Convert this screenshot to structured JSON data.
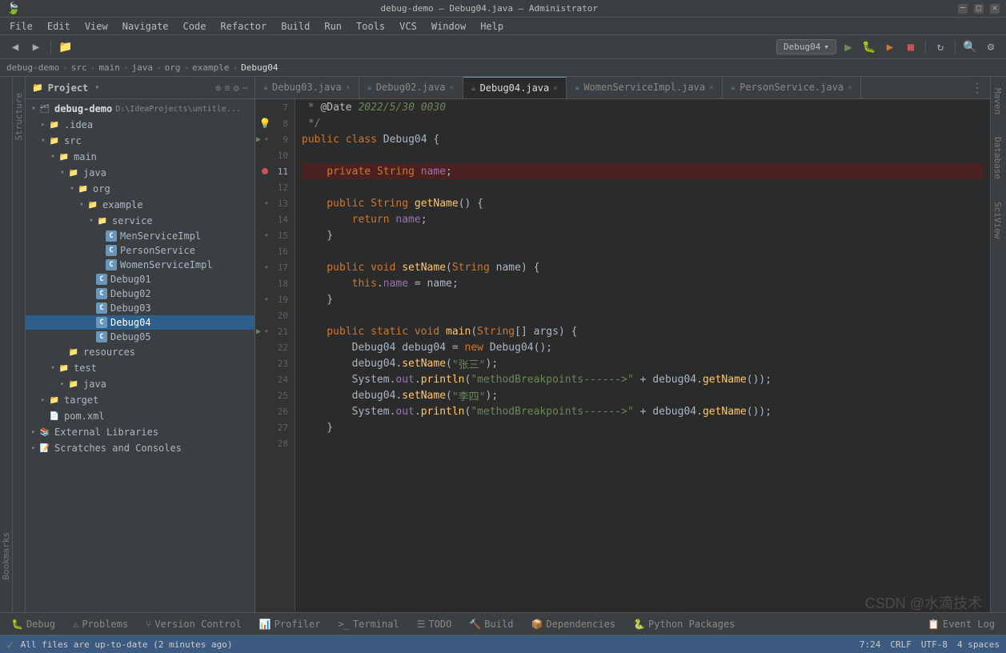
{
  "titleBar": {
    "title": "debug-demo – Debug04.java – Administrator",
    "menuItems": [
      "File",
      "Edit",
      "View",
      "Navigate",
      "Code",
      "Refactor",
      "Build",
      "Run",
      "Tools",
      "VCS",
      "Window",
      "Help"
    ]
  },
  "toolbar": {
    "runConfig": "Debug04",
    "breadcrumb": [
      "debug-demo",
      "src",
      "main",
      "java",
      "org",
      "example",
      "Debug04"
    ]
  },
  "tabs": [
    {
      "name": "Debug03.java",
      "active": false,
      "modified": false
    },
    {
      "name": "Debug02.java",
      "active": false,
      "modified": false
    },
    {
      "name": "Debug04.java",
      "active": true,
      "modified": false
    },
    {
      "name": "WomenServiceImpl.java",
      "active": false,
      "modified": false
    },
    {
      "name": "PersonService.java",
      "active": false,
      "modified": false
    }
  ],
  "tree": {
    "title": "Project",
    "items": [
      {
        "label": "debug-demo",
        "type": "project",
        "indent": 0,
        "open": true,
        "path": "D:\\IdeaProjects\\untitle..."
      },
      {
        "label": ".idea",
        "type": "folder",
        "indent": 1,
        "open": false
      },
      {
        "label": "src",
        "type": "folder-src",
        "indent": 1,
        "open": true
      },
      {
        "label": "main",
        "type": "folder",
        "indent": 2,
        "open": true
      },
      {
        "label": "java",
        "type": "folder-java",
        "indent": 3,
        "open": true
      },
      {
        "label": "org",
        "type": "folder",
        "indent": 4,
        "open": true
      },
      {
        "label": "example",
        "type": "folder",
        "indent": 5,
        "open": true
      },
      {
        "label": "service",
        "type": "folder",
        "indent": 6,
        "open": true
      },
      {
        "label": "MenServiceImpl",
        "type": "class",
        "indent": 7
      },
      {
        "label": "PersonService",
        "type": "class",
        "indent": 7
      },
      {
        "label": "WomenServiceImpl",
        "type": "class",
        "indent": 7
      },
      {
        "label": "Debug01",
        "type": "class",
        "indent": 6
      },
      {
        "label": "Debug02",
        "type": "class",
        "indent": 6
      },
      {
        "label": "Debug03",
        "type": "class",
        "indent": 6
      },
      {
        "label": "Debug04",
        "type": "class",
        "indent": 6,
        "selected": true
      },
      {
        "label": "Debug05",
        "type": "class",
        "indent": 6
      },
      {
        "label": "resources",
        "type": "folder-res",
        "indent": 3
      },
      {
        "label": "test",
        "type": "folder-test",
        "indent": 2,
        "open": true
      },
      {
        "label": "java",
        "type": "folder-java",
        "indent": 3,
        "open": false
      },
      {
        "label": "target",
        "type": "folder",
        "indent": 1,
        "open": false
      },
      {
        "label": "pom.xml",
        "type": "xml",
        "indent": 1
      },
      {
        "label": "External Libraries",
        "type": "external",
        "indent": 0,
        "open": false
      },
      {
        "label": "Scratches and Consoles",
        "type": "scratches",
        "indent": 0,
        "open": false
      }
    ]
  },
  "code": {
    "lines": [
      {
        "num": 7,
        "content": " * @Date 2022/5/30 0030",
        "type": "comment-annotation"
      },
      {
        "num": 8,
        "content": " */",
        "type": "comment",
        "hasBulb": true
      },
      {
        "num": 9,
        "content": "public class Debug04 {",
        "type": "code",
        "hasRun": true,
        "hasFold": true
      },
      {
        "num": 10,
        "content": "",
        "type": "code"
      },
      {
        "num": 11,
        "content": "    private String name;",
        "type": "code",
        "breakpoint": true,
        "isBreakpointLine": true
      },
      {
        "num": 12,
        "content": "",
        "type": "code"
      },
      {
        "num": 13,
        "content": "    public String getName() {",
        "type": "code",
        "hasFold": true
      },
      {
        "num": 14,
        "content": "        return name;",
        "type": "code"
      },
      {
        "num": 15,
        "content": "    }",
        "type": "code",
        "hasFold": true
      },
      {
        "num": 16,
        "content": "",
        "type": "code"
      },
      {
        "num": 17,
        "content": "    public void setName(String name) {",
        "type": "code",
        "hasFold": true
      },
      {
        "num": 18,
        "content": "        this.name = name;",
        "type": "code"
      },
      {
        "num": 19,
        "content": "    }",
        "type": "code",
        "hasFold": true
      },
      {
        "num": 20,
        "content": "",
        "type": "code"
      },
      {
        "num": 21,
        "content": "    public static void main(String[] args) {",
        "type": "code",
        "hasRun": true,
        "hasFold": true
      },
      {
        "num": 22,
        "content": "        Debug04 debug04 = new Debug04();",
        "type": "code"
      },
      {
        "num": 23,
        "content": "        debug04.setName(\"张三\");",
        "type": "code"
      },
      {
        "num": 24,
        "content": "        System.out.println(\"methodBreakpoints------>\") + debug04.getName());",
        "type": "code"
      },
      {
        "num": 25,
        "content": "        debug04.setName(\"李四\");",
        "type": "code"
      },
      {
        "num": 26,
        "content": "        System.out.println(\"methodBreakpoints------>\") + debug04.getName());",
        "type": "code"
      },
      {
        "num": 27,
        "content": "    }",
        "type": "code"
      },
      {
        "num": 28,
        "content": "",
        "type": "code"
      }
    ]
  },
  "bottomTabs": [
    {
      "label": "Debug",
      "icon": "🐛"
    },
    {
      "label": "Problems",
      "icon": "⚠"
    },
    {
      "label": "Version Control",
      "icon": "⑂"
    },
    {
      "label": "Profiler",
      "icon": "📊"
    },
    {
      "label": "Terminal",
      "icon": ">"
    },
    {
      "label": "TODO",
      "icon": "☰"
    },
    {
      "label": "Build",
      "icon": "🔨"
    },
    {
      "label": "Dependencies",
      "icon": "📦"
    },
    {
      "label": "Python Packages",
      "icon": "🐍"
    },
    {
      "label": "Event Log",
      "icon": "📋"
    }
  ],
  "statusBar": {
    "message": "All files are up-to-date (2 minutes ago)",
    "position": "7:24",
    "lineEnding": "CRLF",
    "encoding": "UTF-8",
    "indent": "4 spaces"
  },
  "watermark": "CSDN @水滴技术",
  "sideLabels": {
    "bookmarks": "Bookmarks",
    "structure": "Structure",
    "maven": "Maven",
    "database": "Database",
    "scmView": "SciView"
  }
}
